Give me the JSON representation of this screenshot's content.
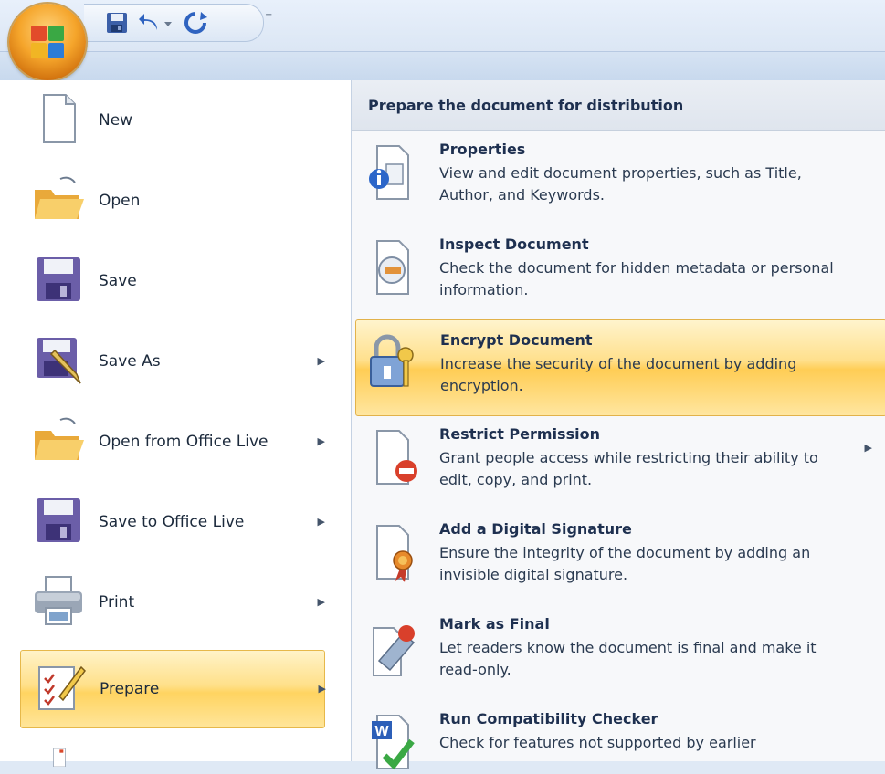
{
  "quick_access": {
    "customize_glyph": "⁼",
    "icons": [
      "save-icon",
      "undo-icon",
      "undo-dropdown-icon",
      "redo-icon"
    ]
  },
  "left_menu": {
    "items": [
      {
        "label": "New",
        "icon": "new-document-icon",
        "has_submenu": false
      },
      {
        "label": "Open",
        "icon": "open-folder-icon",
        "has_submenu": false
      },
      {
        "label": "Save",
        "icon": "save-icon",
        "has_submenu": false
      },
      {
        "label": "Save As",
        "icon": "save-as-icon",
        "has_submenu": true
      },
      {
        "label": "Open from Office Live",
        "icon": "open-folder-icon",
        "has_submenu": true
      },
      {
        "label": "Save to Office Live",
        "icon": "save-icon",
        "has_submenu": true
      },
      {
        "label": "Print",
        "icon": "printer-icon",
        "has_submenu": true
      },
      {
        "label": "Prepare",
        "icon": "prepare-icon",
        "has_submenu": true,
        "selected": true
      }
    ]
  },
  "right_panel": {
    "header": "Prepare the document for distribution",
    "items": [
      {
        "title": "Properties",
        "description": "View and edit document properties, such as Title, Author, and Keywords.",
        "icon": "properties-icon"
      },
      {
        "title": "Inspect Document",
        "description": "Check the document for hidden metadata or personal information.",
        "icon": "inspect-document-icon"
      },
      {
        "title": "Encrypt Document",
        "description": "Increase the security of the document by adding encryption.",
        "icon": "encrypt-lock-icon",
        "selected": true
      },
      {
        "title": "Restrict Permission",
        "description": "Grant people access while restricting their ability to edit, copy, and print.",
        "icon": "restrict-permission-icon",
        "has_submenu": true
      },
      {
        "title": "Add a Digital Signature",
        "description": "Ensure the integrity of the document by adding an invisible digital signature.",
        "icon": "digital-signature-icon"
      },
      {
        "title": "Mark as Final",
        "description": "Let readers know the document is final and make it read-only.",
        "icon": "mark-final-icon"
      },
      {
        "title": "Run Compatibility Checker",
        "description": "Check for features not supported by earlier",
        "icon": "compatibility-checker-icon"
      }
    ]
  },
  "colors": {
    "highlight": "#ffd461",
    "header_text": "#1e3050",
    "ribbon_blue": "#dbe6f4"
  }
}
